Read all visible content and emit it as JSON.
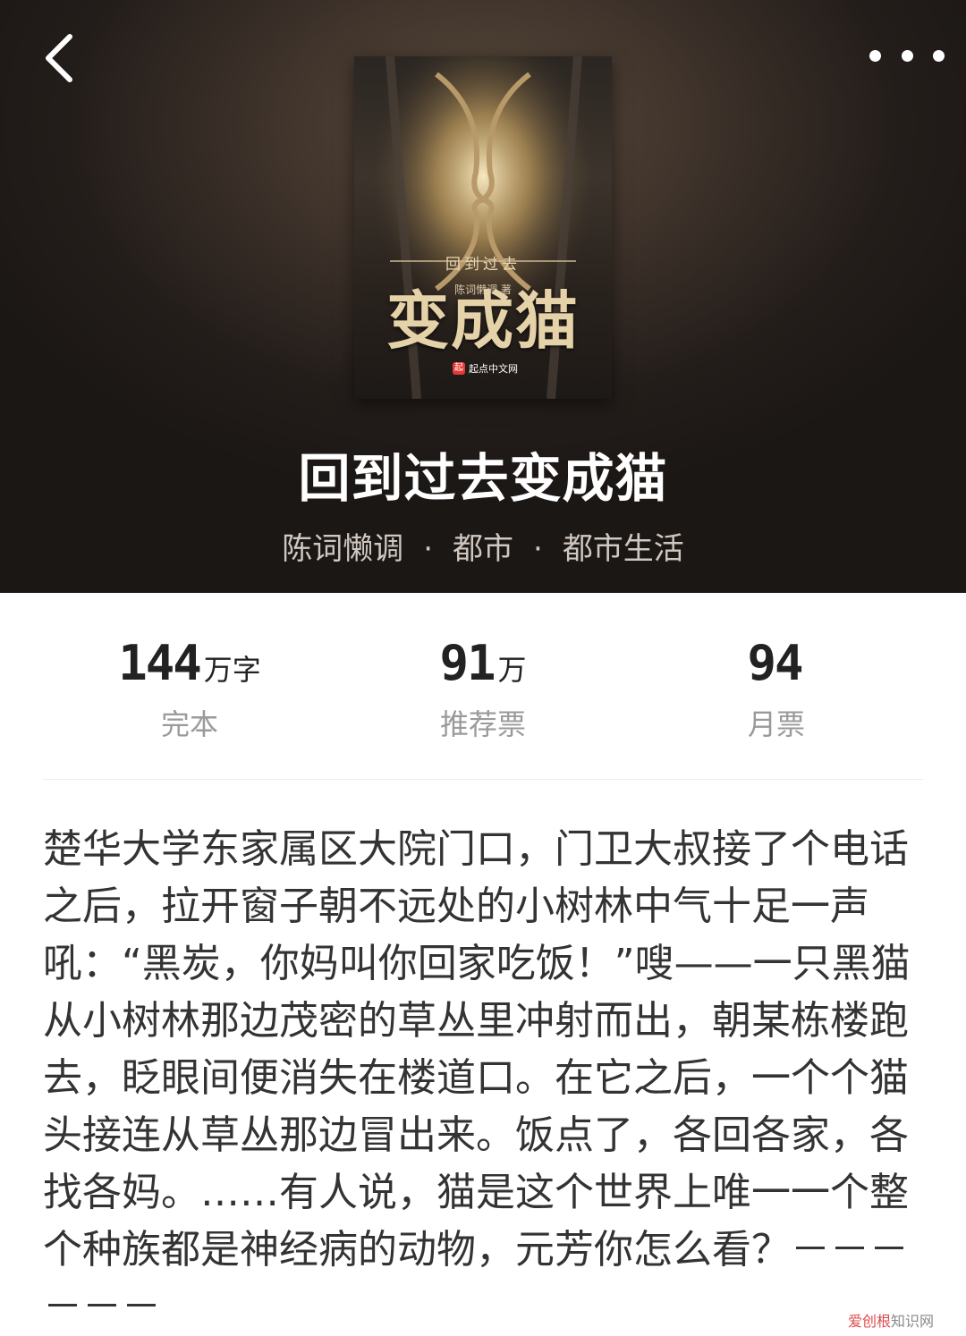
{
  "header": {
    "back_icon": "chevron-left-icon",
    "more_icon": "more-dots-icon"
  },
  "cover": {
    "small_author_text": "陈词懒调 著",
    "subtitle": "回到过去",
    "title": "变成猫",
    "publisher": "起点中文网",
    "publisher_logo_char": "起"
  },
  "book": {
    "title": "回到过去变成猫",
    "author": "陈词懒调",
    "separator": "·",
    "category": "都市",
    "subcategory": "都市生活"
  },
  "stats": [
    {
      "value": "144",
      "unit": "万字",
      "label": "完本"
    },
    {
      "value": "91",
      "unit": "万",
      "label": "推荐票"
    },
    {
      "value": "94",
      "unit": "",
      "label": "月票"
    }
  ],
  "description": "楚华大学东家属区大院门口，门卫大叔接了个电话之后，拉开窗子朝不远处的小树林中气十足一声吼：“黑炭，你妈叫你回家吃饭！”嗖——一只黑猫从小树林那边茂密的草丛里冲射而出，朝某栋楼跑去，眨眼间便消失在楼道口。在它之后，一个个猫头接连从草丛那边冒出来。饭点了，各回各家，各找各妈。……有人说，猫是这个世界上唯一一个整个种族都是神经病的动物，元芳你怎么看？－－－－－－",
  "watermark": {
    "brand": "爱创根",
    "suffix": "知识网"
  },
  "colors": {
    "hero_bg": "#2a231f",
    "title_white": "#ffffff",
    "meta_gray": "#cfc7c0",
    "stat_label_gray": "#9a9a9a",
    "text_dark": "#333333",
    "publisher_red": "#e53935"
  }
}
